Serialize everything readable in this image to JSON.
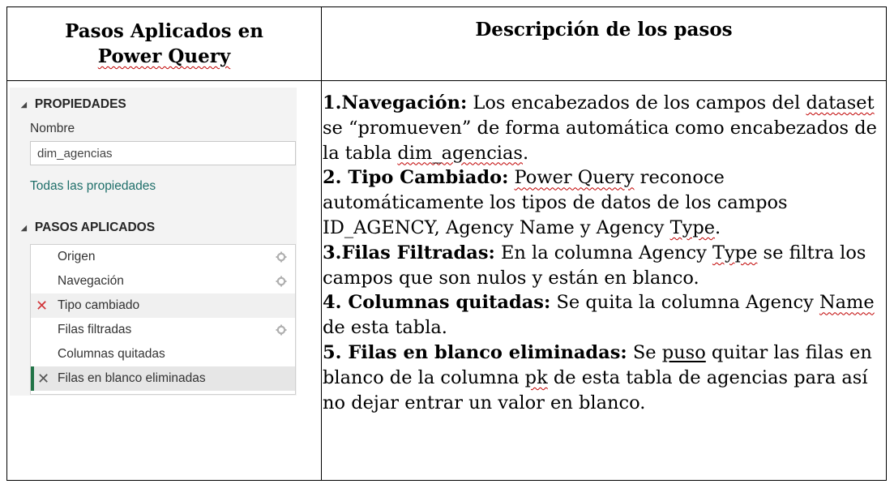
{
  "table": {
    "headers": {
      "left_line1": "Pasos Aplicados en",
      "left_line2": "Power Query",
      "right": "Descripción de los pasos"
    }
  },
  "panel": {
    "properties_title": "PROPIEDADES",
    "name_label": "Nombre",
    "name_value": "dim_agencias",
    "all_properties_link": "Todas las propiedades",
    "applied_steps_title": "PASOS APLICADOS",
    "steps": [
      {
        "label": "Origen",
        "has_gear": true,
        "mark": ""
      },
      {
        "label": "Navegación",
        "has_gear": true,
        "mark": ""
      },
      {
        "label": "Tipo cambiado",
        "has_gear": false,
        "mark": "✕"
      },
      {
        "label": "Filas filtradas",
        "has_gear": true,
        "mark": ""
      },
      {
        "label": "Columnas quitadas",
        "has_gear": false,
        "mark": ""
      },
      {
        "label": "Filas en blanco eliminadas",
        "has_gear": false,
        "mark": "✕",
        "selected": true
      }
    ],
    "colors": {
      "link": "#1f6f6a",
      "error_mark": "#d13438",
      "selected_bar": "#217346"
    }
  },
  "description": {
    "p1_title": "1.Navegación:",
    "p1_a": " Los encabezados de los campos del ",
    "p1_dataset": "dataset",
    "p1_b": " se “promueven” de forma automática como encabezados de la tabla ",
    "p1_table": "dim_agencias",
    "p1_c": ".",
    "p2_title": "2. Tipo Cambiado:",
    "p2_a": " ",
    "p2_pq": "Power Query",
    "p2_b": " reconoce automáticamente los tipos de datos de los campos ID_AGENCY, Agency Name y Agency ",
    "p2_type": "Type",
    "p2_c": ".",
    "p3_title": "3.Filas Filtradas:",
    "p3_a": " En la columna Agency ",
    "p3_type": "Type",
    "p3_b": " se filtra los campos que son nulos y están en blanco.",
    "p4_title": "4. Columnas quitadas:",
    "p4_a": " Se quita la columna Agency ",
    "p4_name": "Name",
    "p4_b": " de esta tabla.",
    "p5_title": "5. Filas en blanco eliminadas:",
    "p5_a": " Se ",
    "p5_puso": "puso",
    "p5_b": " quitar las filas en blanco de la columna ",
    "p5_pk": "pk",
    "p5_c": " de esta tabla de agencias para así no dejar entrar un valor en blanco."
  }
}
